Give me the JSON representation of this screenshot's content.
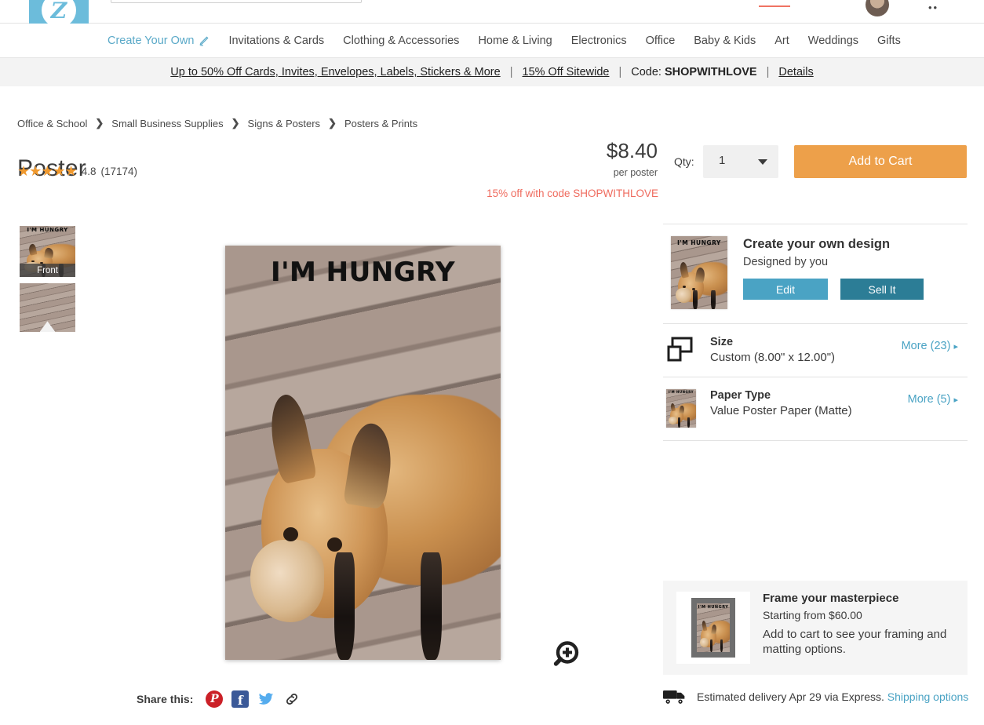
{
  "brand": {
    "name": "Zazzle",
    "logo_mark": "Z",
    "color": "#6cbcdb"
  },
  "search": {
    "placeholder": "",
    "value": "",
    "icon": "search-icon"
  },
  "utility": {
    "avatar": "user-avatar",
    "cart": "cart-icon"
  },
  "nav": {
    "items": [
      {
        "label": "Create Your Own",
        "icon": "pencil-icon",
        "highlight": true
      },
      {
        "label": "Invitations & Cards"
      },
      {
        "label": "Clothing & Accessories"
      },
      {
        "label": "Home & Living"
      },
      {
        "label": "Electronics"
      },
      {
        "label": "Office"
      },
      {
        "label": "Baby & Kids"
      },
      {
        "label": "Art"
      },
      {
        "label": "Weddings"
      },
      {
        "label": "Gifts"
      }
    ]
  },
  "promo_bar": {
    "offer1": "Up to 50% Off Cards, Invites, Envelopes, Labels, Stickers & More",
    "offer2": "15% Off Sitewide",
    "code_label": "Code:",
    "code": "SHOPWITHLOVE",
    "details": "Details",
    "separator": "|"
  },
  "breadcrumb": {
    "items": [
      "Office & School",
      "Small Business Supplies",
      "Signs & Posters",
      "Posters & Prints"
    ],
    "separator": "❯"
  },
  "product": {
    "title": "Poster",
    "rating_stars": "★★★★★",
    "rating_value": "4.8",
    "rating_count": "(17174)",
    "price": "$8.40",
    "price_unit": "per poster",
    "discount_note": "15% off with code SHOPWITHLOVE",
    "qty_label": "Qty:",
    "qty_value": "1",
    "add_to_cart": "Add to Cart",
    "poster_caption": "I'M HUNGRY"
  },
  "gallery": {
    "thumbnails": [
      {
        "label": "Front",
        "selected": true
      },
      {
        "label": "",
        "selected": false
      }
    ],
    "zoom_icon": "zoom-in-icon"
  },
  "share": {
    "label": "Share this:",
    "items": [
      {
        "name": "pinterest-icon",
        "glyph": "P"
      },
      {
        "name": "facebook-icon",
        "glyph": "f"
      },
      {
        "name": "twitter-icon",
        "glyph": "twitter"
      },
      {
        "name": "copy-link-icon",
        "glyph": "link"
      }
    ]
  },
  "design_panel": {
    "title": "Create your own design",
    "subtitle": "Designed by you",
    "edit_label": "Edit",
    "sell_label": "Sell It"
  },
  "options": [
    {
      "icon": "size-icon",
      "name": "Size",
      "value": "Custom (8.00\" x 12.00\")",
      "more": "More (23)",
      "arrow": "▸"
    },
    {
      "icon": "paper-swatch-icon",
      "name": "Paper Type",
      "value": "Value Poster Paper (Matte)",
      "more": "More (5)",
      "arrow": "▸"
    }
  ],
  "frame_promo": {
    "title": "Frame your masterpiece",
    "price": "Starting from $60.00",
    "note": "Add to cart to see your framing and matting options."
  },
  "delivery": {
    "icon": "truck-icon",
    "text": "Estimated delivery Apr 29 via Express.",
    "link": "Shipping options"
  },
  "colors": {
    "accent_blue": "#4aa3c4",
    "brand_blue": "#6cbcdb",
    "cart_orange": "#eda04a",
    "star_orange": "#f0992e",
    "promo_red": "#ef6b5e",
    "sell_teal": "#2c7d96"
  }
}
